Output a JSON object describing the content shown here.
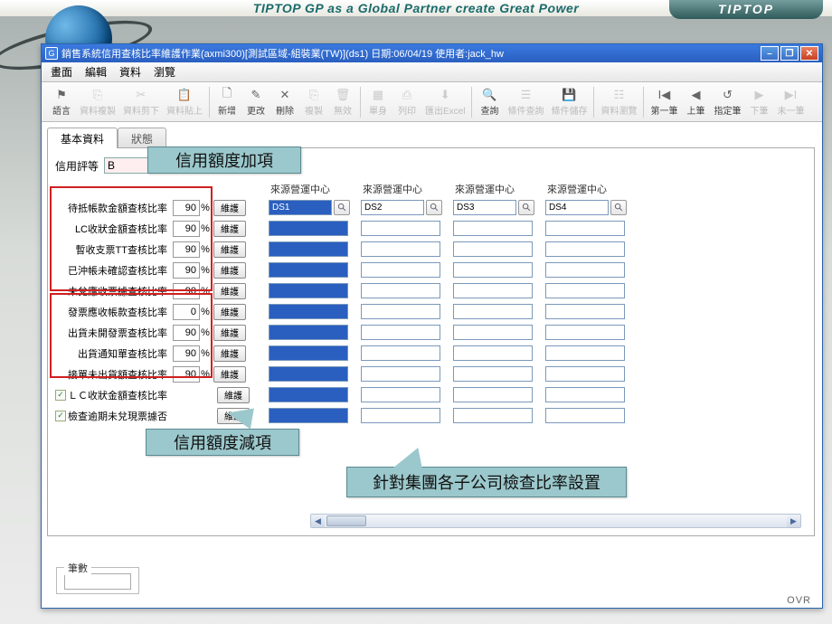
{
  "banner": {
    "slogan": "TIPTOP GP as a Global Partner create Great Power",
    "brand": "TIPTOP"
  },
  "window": {
    "title": "銷售系統信用查核比率維護作業(axmi300)[測試區域-組裝業(TW)](ds1)  日期:06/04/19  使用者:jack_hw"
  },
  "menu": {
    "m1": "畫面",
    "m2": "編輯",
    "m3": "資料",
    "m4": "瀏覽"
  },
  "toolbar": {
    "lang": "語言",
    "copy": "資料複製",
    "cut": "資料剪下",
    "paste": "資料貼上",
    "new": "新增",
    "edit": "更改",
    "del": "刪除",
    "dup": "複製",
    "void": "無效",
    "single": "單身",
    "print": "列印",
    "excel": "匯出Excel",
    "query": "查詢",
    "condq": "條件查詢",
    "condsave": "條件儲存",
    "browse": "資料瀏覽",
    "first": "第一筆",
    "prev": "上筆",
    "goto": "指定筆",
    "next": "下筆",
    "last": "未一筆"
  },
  "tabs": {
    "t1": "基本資料",
    "t2": "狀態"
  },
  "credit": {
    "label": "信用評等",
    "value": "B"
  },
  "callouts": {
    "add": "信用額度加項",
    "sub": "信用額度減項",
    "group": "針對集團各子公司檢查比率設置"
  },
  "pct_sign": "%",
  "maint": "維護",
  "rows": [
    {
      "label": "待抵帳款金額查核比率",
      "pct": "90",
      "chk": false
    },
    {
      "label": "LC收狀金額查核比率",
      "pct": "90",
      "chk": false
    },
    {
      "label": "暫收支票TT查核比率",
      "pct": "90",
      "chk": false
    },
    {
      "label": "已沖帳未確認查核比率",
      "pct": "90",
      "chk": false
    },
    {
      "label": "未兌應收票據查核比率",
      "pct": "90",
      "chk": false
    },
    {
      "label": "發票應收帳款查核比率",
      "pct": "0",
      "chk": false
    },
    {
      "label": "出貨未開發票查核比率",
      "pct": "90",
      "chk": false
    },
    {
      "label": "出貨通知單查核比率",
      "pct": "90",
      "chk": false
    },
    {
      "label": "接單未出貨額查核比率",
      "pct": "90",
      "chk": false
    },
    {
      "label": "ＬＣ收狀金額查核比率",
      "pct": "",
      "chk": true
    },
    {
      "label": "檢查逾期未兌現票據否",
      "pct": "",
      "chk": true
    }
  ],
  "src": {
    "head": "來源營運中心",
    "cols": [
      "DS1",
      "DS2",
      "DS3",
      "DS4"
    ]
  },
  "footer": {
    "count_label": "筆數",
    "ovr": "OVR"
  }
}
